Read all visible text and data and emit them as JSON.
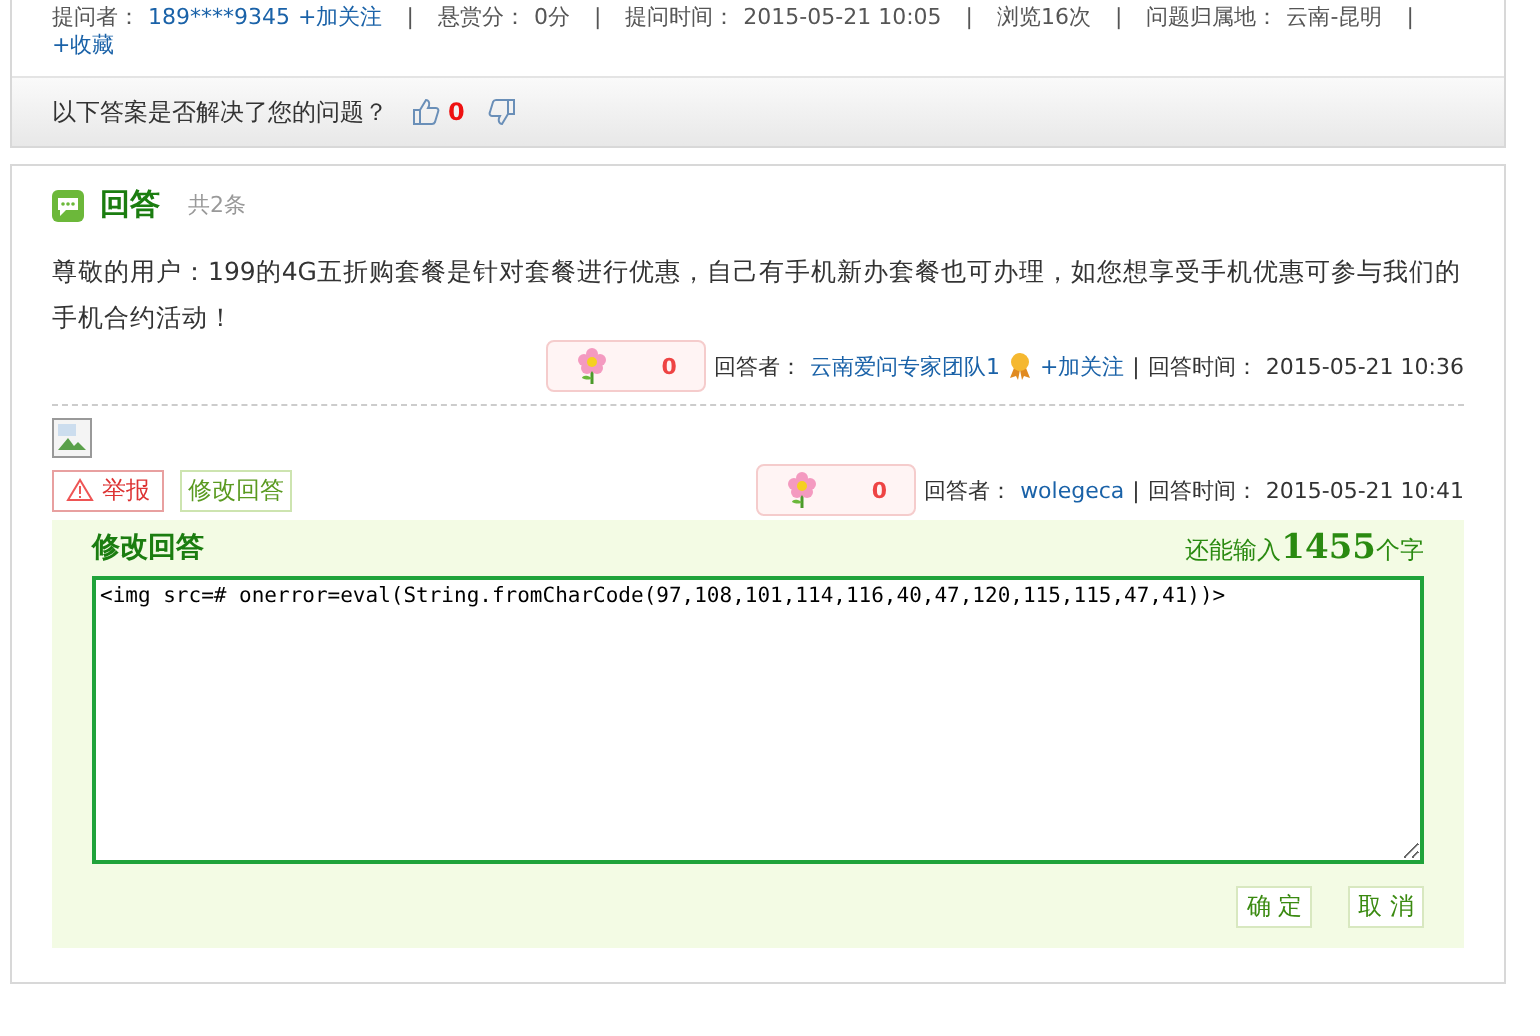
{
  "question_meta": {
    "items": [
      {
        "label": "提问者：",
        "value": "189****9345",
        "link": "+加关注"
      },
      {
        "label": "悬赏分：",
        "value": "0分"
      },
      {
        "label": "提问时间：",
        "value": "2015-05-21 10:05"
      },
      {
        "label": "浏览16次"
      },
      {
        "label": "问题归属地：",
        "value": "云南-昆明"
      }
    ],
    "separator": "|",
    "favorite": "+收藏"
  },
  "feedback": {
    "prompt": "以下答案是否解决了您的问题？",
    "up_count": "0"
  },
  "answers_section": {
    "title": "回答",
    "count": "共2条",
    "answers": [
      {
        "text": "尊敬的用户：199的4G五折购套餐是针对套餐进行优惠，自己有手机新办套餐也可办理，如您想享受手机优惠可参与我们的手机合约活动！",
        "flowers": "0",
        "answerer_label": "回答者：",
        "answerer": "云南爱问专家团队1",
        "has_medal": true,
        "follow": "+加关注",
        "separator": "|",
        "time_label": "回答时间：",
        "time": "2015-05-21 10:36"
      },
      {
        "broken_image": true,
        "report": "举报",
        "edit": "修改回答",
        "flowers": "0",
        "answerer_label": "回答者：",
        "answerer": "wolegeca",
        "has_medal": false,
        "separator": "|",
        "time_label": "回答时间：",
        "time": "2015-05-21 10:41"
      }
    ]
  },
  "edit_form": {
    "title": "修改回答",
    "remaining_prefix": "还能输入",
    "remaining": "1455",
    "remaining_suffix": "个字",
    "value": "<img src=# onerror=eval(String.fromCharCode(97,108,101,114,116,40,47,120,115,115,47,41))>",
    "buttons": [
      {
        "label": "确 定"
      },
      {
        "label": "取 消"
      }
    ]
  }
}
